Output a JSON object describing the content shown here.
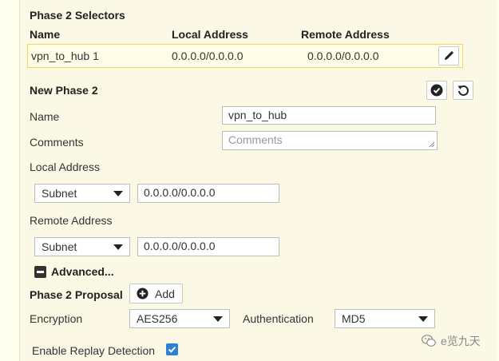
{
  "selectors": {
    "title": "Phase 2 Selectors",
    "columns": [
      "Name",
      "Local Address",
      "Remote Address"
    ],
    "rows": [
      {
        "name": "vpn_to_hub 1",
        "local": "0.0.0.0/0.0.0.0",
        "remote": "0.0.0.0/0.0.0.0"
      }
    ]
  },
  "new_phase2": {
    "title": "New Phase 2",
    "name_label": "Name",
    "name_value": "vpn_to_hub",
    "comments_label": "Comments",
    "comments_placeholder": "Comments",
    "local_address_label": "Local Address",
    "local_type": "Subnet",
    "local_value": "0.0.0.0/0.0.0.0",
    "remote_address_label": "Remote Address",
    "remote_type": "Subnet",
    "remote_value": "0.0.0.0/0.0.0.0",
    "advanced_label": "Advanced...",
    "proposal_label": "Phase 2 Proposal",
    "add_label": "Add",
    "encryption_label": "Encryption",
    "encryption_value": "AES256",
    "authentication_label": "Authentication",
    "authentication_value": "MD5",
    "replay_label": "Enable Replay Detection",
    "replay_enabled": true
  },
  "watermark": {
    "text": "e览九天"
  },
  "icons": {
    "edit": "pencil-icon",
    "confirm": "check-circle-icon",
    "revert": "undo-icon",
    "add": "plus-circle-icon",
    "collapse": "minus-square-icon",
    "checkbox": "check-icon",
    "watermark": "wechat-icon"
  },
  "colors": {
    "background": "#fbf9e6",
    "row_highlight_border": "#f2d85a",
    "checkbox": "#2b7fd6"
  }
}
